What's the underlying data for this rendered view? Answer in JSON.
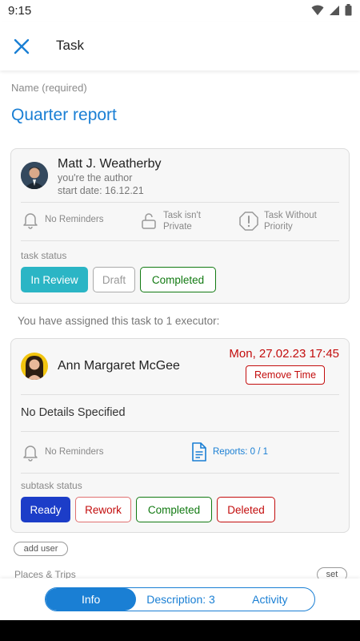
{
  "status_bar": {
    "time": "9:15"
  },
  "app_bar": {
    "title": "Task"
  },
  "task": {
    "name_label": "Name (required)",
    "name": "Quarter report"
  },
  "author_card": {
    "name": "Matt J. Weatherby",
    "role": "you're the author",
    "start_date": "start date: 16.12.21",
    "reminders": "No Reminders",
    "privacy_line1": "Task isn't",
    "privacy_line2": "Private",
    "priority_line1": "Task Without",
    "priority_line2": "Priority",
    "status_label": "task status",
    "statuses": [
      "In Review",
      "Draft",
      "Completed"
    ]
  },
  "assign_text": "You have assigned this task to 1 executor:",
  "executor_card": {
    "name": "Ann Margaret McGee",
    "date": "Mon, 27.02.23 17:45",
    "remove_time": "Remove Time",
    "details": "No Details Specified",
    "reminders": "No Reminders",
    "reports": "Reports: 0 / 1",
    "status_label": "subtask status",
    "statuses": [
      "Ready",
      "Rework",
      "Completed",
      "Deleted"
    ]
  },
  "add_user": "add user",
  "places": {
    "label": "Places & Trips",
    "set": "set"
  },
  "tabs": [
    "Info",
    "Description: 3",
    "Activity"
  ],
  "colors": {
    "accent": "#1a7fd4",
    "teal": "#2bb5c5",
    "green": "#127a12",
    "red": "#c30d0d",
    "ready": "#1c3dc8"
  }
}
